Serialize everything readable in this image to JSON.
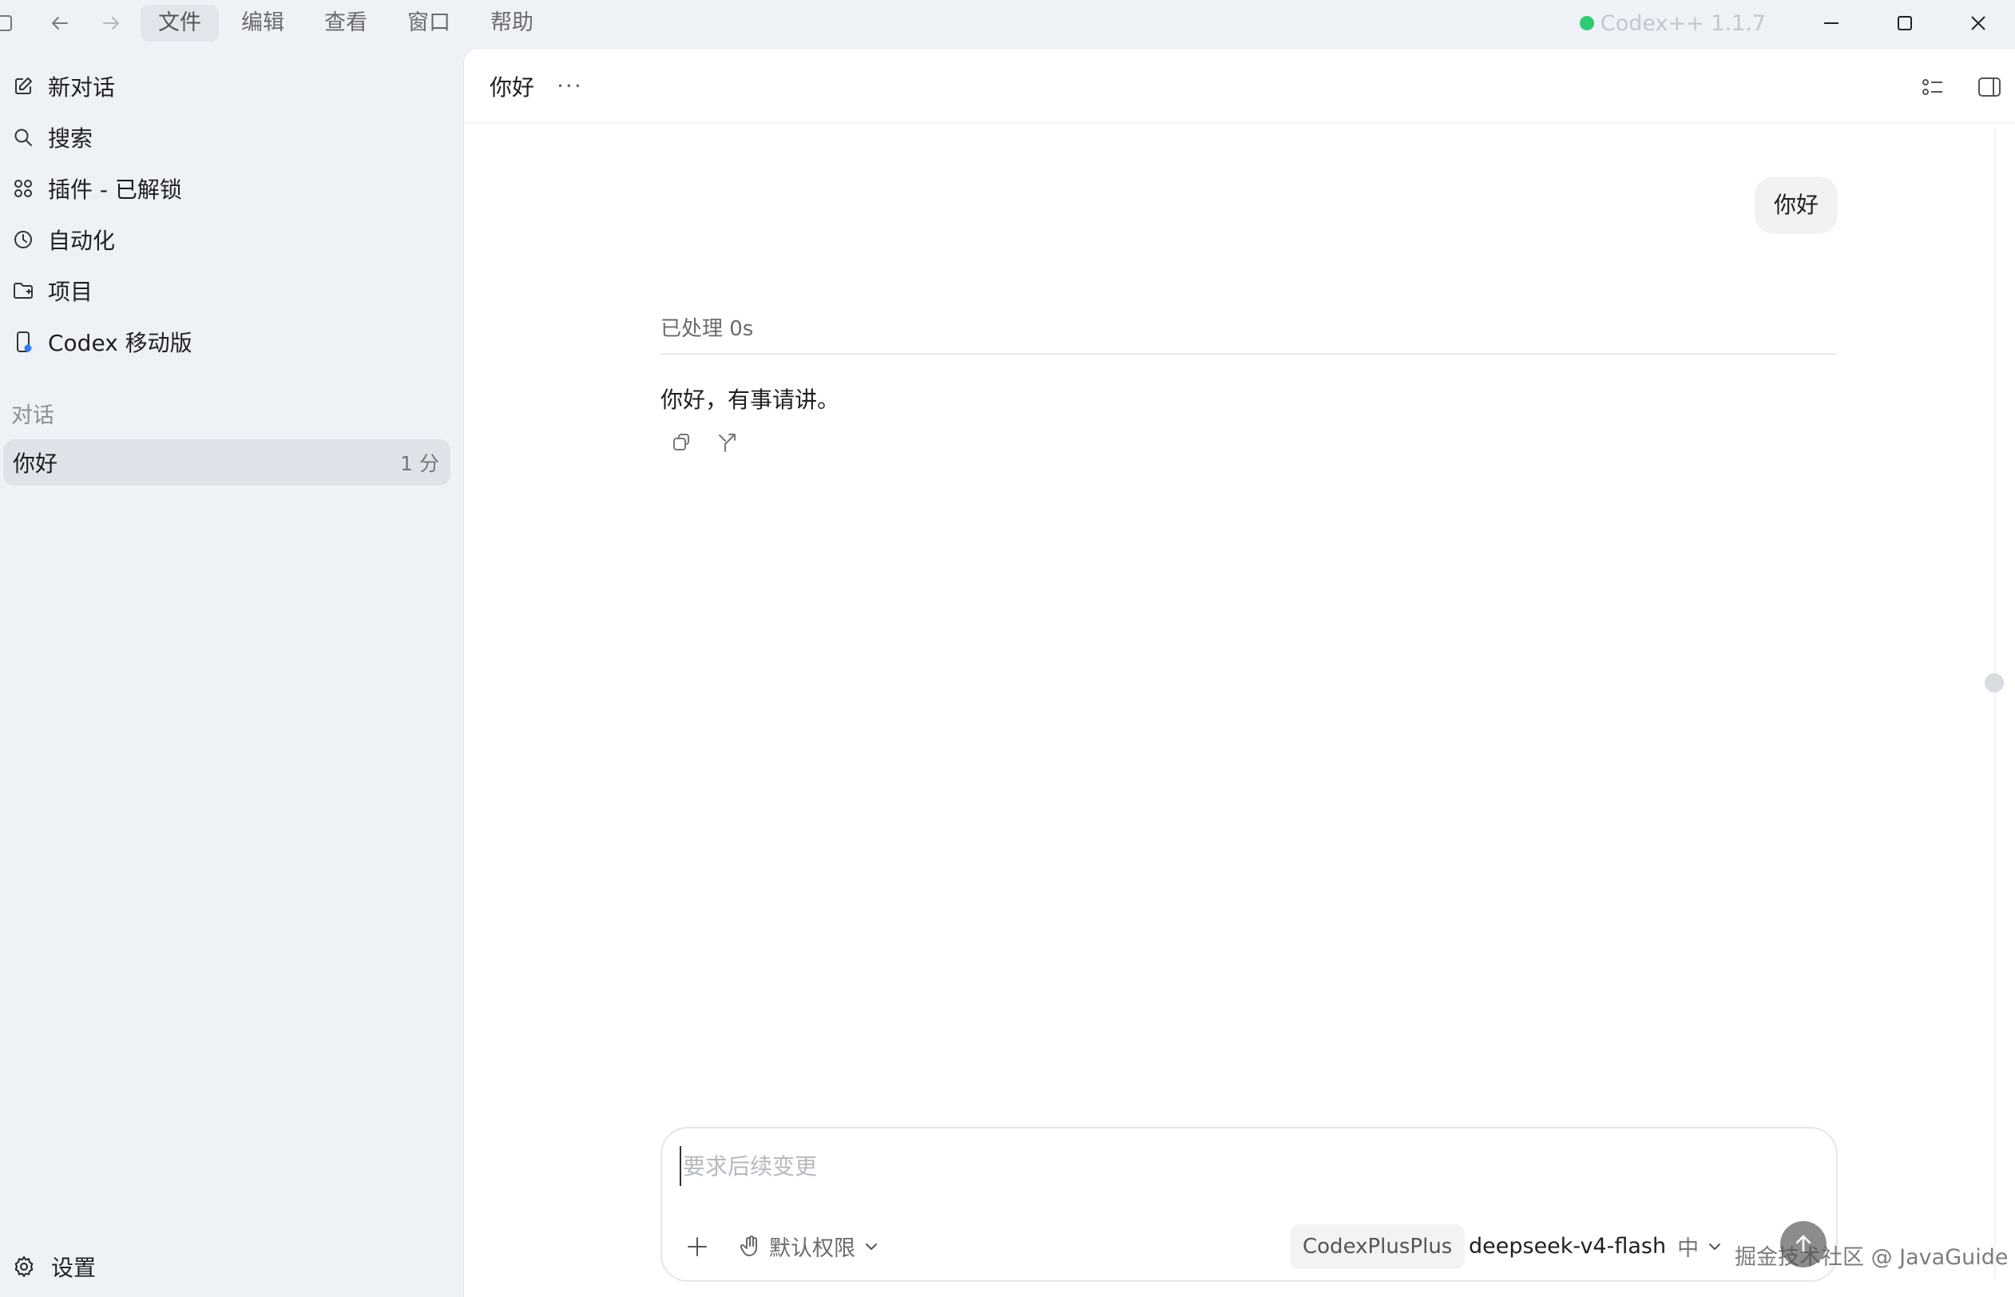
{
  "titlebar": {
    "menu": [
      "文件",
      "编辑",
      "查看",
      "窗口",
      "帮助"
    ],
    "version": "Codex++ 1.1.7",
    "status_color": "#2ecc71"
  },
  "sidebar": {
    "items": [
      {
        "label": "新对话",
        "icon": "edit-icon"
      },
      {
        "label": "搜索",
        "icon": "search-icon"
      },
      {
        "label": "插件 - 已解锁",
        "icon": "grid-icon"
      },
      {
        "label": "自动化",
        "icon": "clock-icon"
      },
      {
        "label": "项目",
        "icon": "folder-icon"
      },
      {
        "label": "Codex 移动版",
        "icon": "phone-icon"
      }
    ],
    "section_label": "对话",
    "conversations": [
      {
        "title": "你好",
        "time": "1 分"
      }
    ],
    "settings_label": "设置"
  },
  "main": {
    "title": "你好",
    "more": "···",
    "user_message": "你好",
    "processed": "已处理 0s",
    "reply": "你好，有事请讲。"
  },
  "composer": {
    "placeholder": "要求后续变更",
    "permission": "默认权限",
    "provider": "CodexPlusPlus",
    "model": "deepseek-v4-flash",
    "effort": "中"
  },
  "watermark": "掘金技术社区 @ JavaGuide"
}
